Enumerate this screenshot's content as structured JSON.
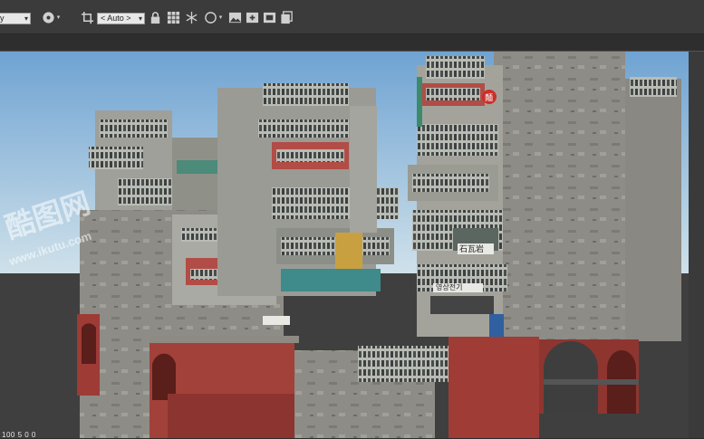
{
  "toolbar": {
    "left_combo_value": "y",
    "aspect_combo_value": "< Auto >",
    "icons": [
      "render-sphere-icon",
      "crop-icon",
      "lock-icon",
      "grid-icon",
      "snowflake-icon",
      "circle-icon",
      "image-icon",
      "add-image-icon",
      "snapshot-icon",
      "copy-icon"
    ]
  },
  "viewport": {
    "scene_description_icon": "3d-render-view",
    "signs": {
      "sign1": "石瓦岩",
      "sign2": "영상전기",
      "sign3": "麵"
    }
  },
  "watermark": {
    "text_cn": "酷图网",
    "text_url": "www.ikutu.com"
  },
  "status": {
    "text": "100 5 0 0"
  },
  "colors": {
    "toolbar_bg": "#3b3b3b",
    "sky_top": "#6fa3d2",
    "sky_bottom": "#cfe1ea",
    "brick": "#9e3b35",
    "concrete": "#8d8b84"
  }
}
